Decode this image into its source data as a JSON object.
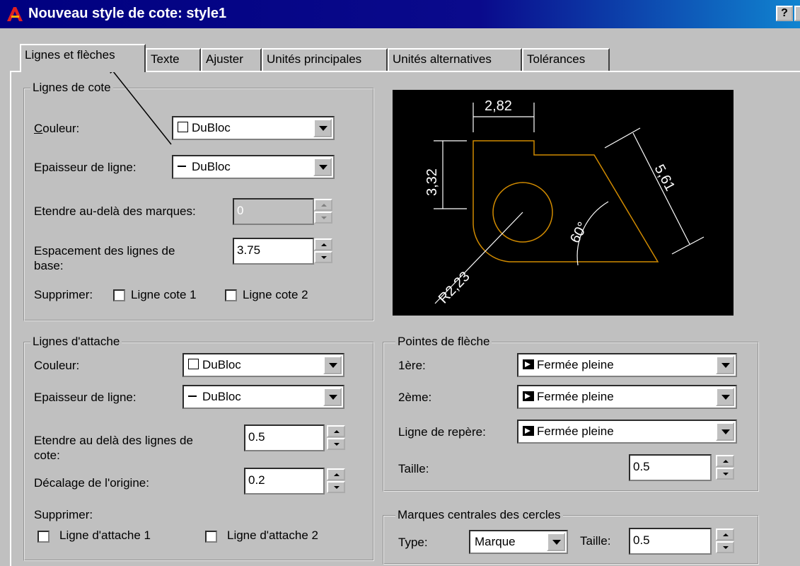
{
  "window": {
    "title": "Nouveau style de cote: style1",
    "help_button": "?"
  },
  "tabs": [
    {
      "label": "Lignes et flèches",
      "active": true
    },
    {
      "label": "Texte"
    },
    {
      "label": "Ajuster"
    },
    {
      "label": "Unités principales"
    },
    {
      "label": "Unités alternatives"
    },
    {
      "label": "Tolérances"
    }
  ],
  "dim_lines": {
    "title": "Lignes de cote",
    "color_label": "Couleur:",
    "color_value": "DuBloc",
    "lineweight_label": "Epaisseur de ligne:",
    "lineweight_value": "DuBloc",
    "extend_label": "Etendre au-delà des marques:",
    "extend_value": "0",
    "baseline_label_1": "Espacement des lignes de",
    "baseline_label_2": "base:",
    "baseline_value": "3.75",
    "suppress_label": "Supprimer:",
    "suppress_1": "Ligne cote 1",
    "suppress_2": "Ligne cote 2"
  },
  "ext_lines": {
    "title": "Lignes d'attache",
    "color_label": "Couleur:",
    "color_value": "DuBloc",
    "lineweight_label": "Epaisseur de ligne:",
    "lineweight_value": "DuBloc",
    "extend_label_1": "Etendre au delà des lignes de",
    "extend_label_2": "cote:",
    "extend_value": "0.5",
    "offset_label": "Décalage de l'origine:",
    "offset_value": "0.2",
    "suppress_label": "Supprimer:",
    "suppress_1": "Ligne d'attache 1",
    "suppress_2": "Ligne d'attache 2"
  },
  "arrowheads": {
    "title": "Pointes de flèche",
    "first_label": "1ère:",
    "first_value": "Fermée pleine",
    "second_label": "2ème:",
    "second_value": "Fermée pleine",
    "leader_label": "Ligne de repère:",
    "leader_value": "Fermée pleine",
    "size_label": "Taille:",
    "size_value": "0.5"
  },
  "center_marks": {
    "title": "Marques centrales des cercles",
    "type_label": "Type:",
    "type_value": "Marque",
    "size_label": "Taille:",
    "size_value": "0.5"
  },
  "preview": {
    "dim_top": "2,82",
    "dim_left": "3,32",
    "dim_diag": "5,61",
    "dim_angle": "60°",
    "dim_radius": "R2,23",
    "colors": {
      "geometry": "#d08a00",
      "dimension": "#ffffff",
      "background": "#000000"
    }
  },
  "colors": {
    "titlebar": "#000080",
    "face": "#c0c0c0"
  }
}
